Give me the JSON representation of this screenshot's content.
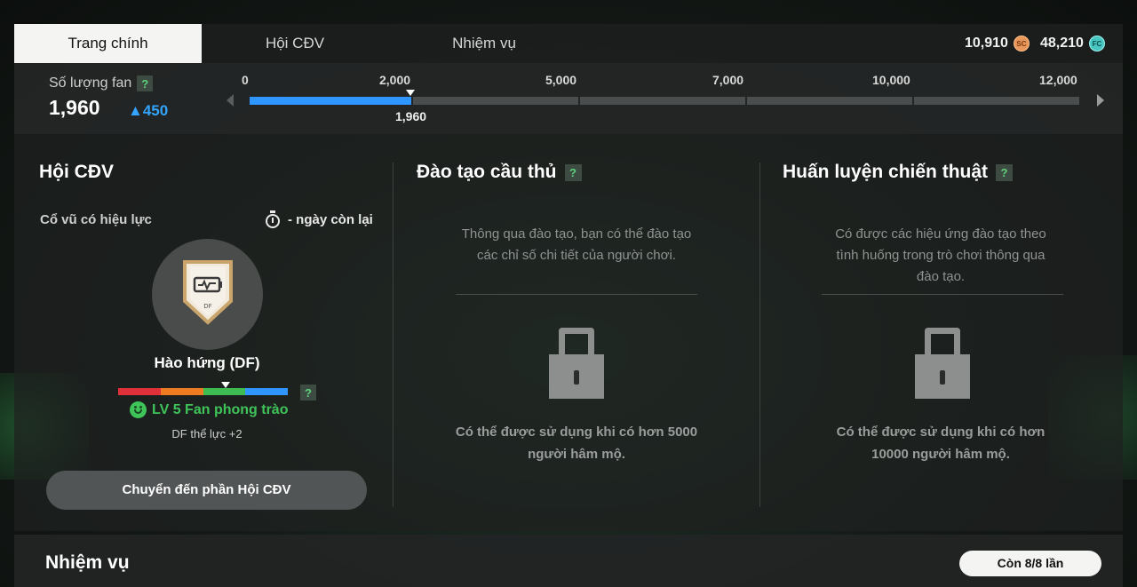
{
  "tabs": [
    {
      "label": "Trang chính",
      "active": true
    },
    {
      "label": "Hội CĐV",
      "active": false
    },
    {
      "label": "Nhiệm vụ",
      "active": false
    }
  ],
  "currency": {
    "sc": {
      "value": "10,910",
      "icon": "sc-coin-icon",
      "label": "SC",
      "color": "#e9975a"
    },
    "fc": {
      "value": "48,210",
      "icon": "fc-coin-icon",
      "label": "FC",
      "color": "#47c6c2"
    }
  },
  "fans": {
    "label": "Số lượng fan",
    "help": "?",
    "value": "1,960",
    "delta": "▲450",
    "progress": {
      "current": 1960,
      "current_label": "1,960",
      "ticks": [
        "0",
        "2,000",
        "5,000",
        "7,000",
        "10,000",
        "12,000"
      ],
      "fill_color": "#2f96ff"
    }
  },
  "fan_club": {
    "title": "Hội CĐV",
    "cheer_label": "Cổ vũ có hiệu lực",
    "days_left": "- ngày còn lại",
    "badge_text": "DF",
    "player": "Hào hứng (DF)",
    "mood_colors": [
      "#e0303a",
      "#ee7a22",
      "#3ebc52",
      "#2f96ff"
    ],
    "mood_level": 0.64,
    "help": "?",
    "level": "LV 5 Fan phong trào",
    "buff": "DF thể lực +2",
    "button": "Chuyển đến phần Hội CĐV"
  },
  "training": {
    "title": "Đào tạo cầu thủ",
    "help": "?",
    "desc_line1": "Thông qua đào tạo, bạn có thể đào tạo",
    "desc_line2": "các chỉ số chi tiết của người chơi.",
    "cond_line1": "Có thể được sử dụng khi có hơn 5000",
    "cond_line2": "người hâm mộ."
  },
  "tactics": {
    "title": "Huấn luyện chiến thuật",
    "help": "?",
    "desc_line1": "Có được các hiệu ứng đào tạo theo",
    "desc_line2": "tình huống trong trò chơi thông qua",
    "desc_line3": "đào tạo.",
    "cond_line1": "Có thể được sử dụng khi có hơn",
    "cond_line2": "10000 người hâm mộ."
  },
  "missions": {
    "title": "Nhiệm vụ",
    "remaining": "Còn 8/8 lần"
  }
}
